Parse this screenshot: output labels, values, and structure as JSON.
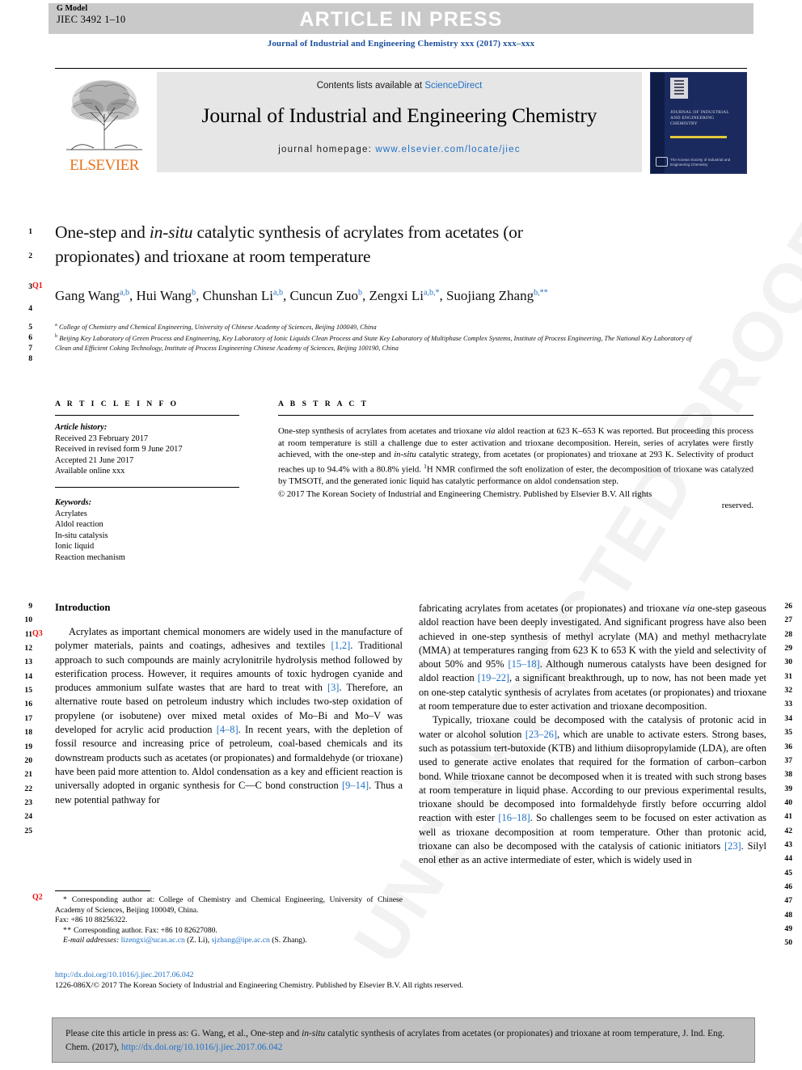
{
  "header": {
    "g_model_label": "G Model",
    "manuscript_id": "JIEC 3492 1–10",
    "article_in_press": "ARTICLE IN PRESS",
    "journal_ref": "Journal of Industrial and Engineering Chemistry xxx (2017) xxx–xxx"
  },
  "masthead": {
    "contents_prefix": "Contents lists available at ",
    "sciencedirect": "ScienceDirect",
    "journal_title": "Journal of Industrial and Engineering Chemistry",
    "homepage_prefix": "journal homepage: ",
    "homepage_url": "www.elsevier.com/locate/jiec",
    "publisher_wordmark": "ELSEVIER",
    "cover_title": "Journal of Industrial and Engineering Chemistry",
    "cover_footer": "The Korean Society of Industrial and Engineering Chemistry"
  },
  "article": {
    "title_line1_a": "One-step and ",
    "title_line1_em": "in-situ",
    "title_line1_b": " catalytic synthesis of acrylates from acetates",
    "title_line2": "(or propionates) and trioxane at room temperature",
    "authors": [
      {
        "name": "Gang Wang",
        "sup": "a,b",
        "sep": ", "
      },
      {
        "name": "Hui Wang",
        "sup": "b",
        "sep": ", "
      },
      {
        "name": "Chunshan Li",
        "sup": "a,b",
        "sep": ", "
      },
      {
        "name": "Cuncun Zuo",
        "sup": "b",
        "sep": ", "
      },
      {
        "name": "Zengxi Li",
        "sup": "a,b,*",
        "sep": ","
      },
      {
        "name": "Suojiang Zhang",
        "sup": "b,**",
        "sep": ""
      }
    ],
    "affiliations": [
      {
        "marker": "a",
        "text": "College of Chemistry and Chemical Engineering, University of Chinese Academy of Sciences, Beijing 100049, China"
      },
      {
        "marker": "b",
        "text": "Beijing Key Laboratory of Green Process and Engineering, Key Laboratory of Ionic Liquids Clean Process and State Key Laboratory of Multiphase Complex Systems, Institute of Process Engineering, The National Key Laboratory of Clean and Efficient Coking Technology, Institute of Process Engineering Chinese Academy of Sciences, Beijing 100190, China"
      }
    ]
  },
  "article_info": {
    "heading": "A R T I C L E  I N F O",
    "history_label": "Article history:",
    "history": [
      "Received 23 February 2017",
      "Received in revised form 9 June 2017",
      "Accepted 21 June 2017",
      "Available online xxx"
    ],
    "keywords_label": "Keywords:",
    "keywords": [
      "Acrylates",
      "Aldol reaction",
      "In-situ catalysis",
      "Ionic liquid",
      "Reaction mechanism"
    ]
  },
  "abstract": {
    "heading": "A B S T R A C T",
    "part1": "One-step synthesis of acrylates from acetates and trioxane ",
    "via1": "via",
    "part2": " aldol reaction at 623 K–653 K was reported. But proceeding this process at room temperature is still a challenge due to ester activation and trioxane decomposition. Herein, series of acrylates were firstly achieved, with the one-step and ",
    "insitu": "in-situ",
    "part3": " catalytic strategy, from acetates (or propionates) and trioxane at 293 K. Selectivity of product reaches up to 94.4% with a 80.8% yield. ",
    "nmr_sup": "1",
    "part4": "H NMR confirmed the soft enolization of ester, the decomposition of trioxane was catalyzed by TMSOTf, and the generated ionic liquid has catalytic performance on aldol condensation step.",
    "copyright": "© 2017 The Korean Society of Industrial and Engineering Chemistry. Published by Elsevier B.V. All rights",
    "copyright_last": "reserved."
  },
  "body": {
    "section_heading": "Introduction",
    "left_paragraphs": [
      {
        "segments": [
          {
            "t": "Acrylates as important chemical monomers are widely used in the manufacture of polymer materials, paints and coatings, adhesives and textiles "
          },
          {
            "t": "[1,2]",
            "k": "ref"
          },
          {
            "t": ". Traditional approach to such compounds are mainly acrylonitrile hydrolysis method followed by esterification process. However, it requires amounts of toxic hydrogen cyanide and produces ammonium sulfate wastes that are hard to treat with "
          },
          {
            "t": "[3]",
            "k": "ref"
          },
          {
            "t": ". Therefore, an alternative route based on petroleum industry which includes two-step oxidation of propylene (or isobutene) over mixed metal oxides of Mo–Bi and Mo–V was developed for acrylic acid production "
          },
          {
            "t": "[4–8]",
            "k": "ref"
          },
          {
            "t": ". In recent years, with the depletion of fossil resource and increasing price of petroleum, coal-based chemicals and its downstream products such as acetates (or propionates) and formaldehyde (or trioxane) have been paid more attention to. Aldol condensation as a key and efficient reaction is universally adopted in organic synthesis for C—C bond construction "
          },
          {
            "t": "[9–14]",
            "k": "ref"
          },
          {
            "t": ". Thus a new potential pathway for"
          }
        ]
      }
    ],
    "right_paragraphs": [
      {
        "indent": false,
        "segments": [
          {
            "t": "fabricating acrylates from acetates (or propionates) and trioxane "
          },
          {
            "t": "via",
            "k": "em"
          },
          {
            "t": " one-step gaseous aldol reaction have been deeply investigated. And significant progress have also been achieved in one-step synthesis of methyl acrylate (MA) and methyl methacrylate (MMA) at temperatures ranging from 623 K to 653 K with the yield and selectivity of about 50% and 95% "
          },
          {
            "t": "[15–18]",
            "k": "ref"
          },
          {
            "t": ". Although numerous catalysts have been designed for aldol reaction "
          },
          {
            "t": "[19–22]",
            "k": "ref"
          },
          {
            "t": ", a significant breakthrough, up to now, has not been made yet on one-step catalytic synthesis of acrylates from acetates (or propionates) and trioxane at room temperature due to ester activation and trioxane decomposition."
          }
        ]
      },
      {
        "indent": true,
        "segments": [
          {
            "t": "Typically, trioxane could be decomposed with the catalysis of protonic acid in water or alcohol solution "
          },
          {
            "t": "[23–26]",
            "k": "ref"
          },
          {
            "t": ", which are unable to activate esters. Strong bases, such as potassium tert-butoxide (KTB) and lithium diisopropylamide (LDA), are often used to generate active enolates that required for the formation of carbon–carbon bond. While trioxane cannot be decomposed when it is treated with such strong bases at room temperature in liquid phase. According to our previous experimental results, trioxane should be decomposed into formaldehyde firstly before occurring aldol reaction with ester "
          },
          {
            "t": "[16–18]",
            "k": "ref"
          },
          {
            "t": ". So challenges seem to be focused on ester activation as well as trioxane decomposition at room temperature. Other than protonic acid, trioxane can also be decomposed with the catalysis of cationic initiators "
          },
          {
            "t": "[23]",
            "k": "ref"
          },
          {
            "t": ". Silyl enol ether as an active intermediate of ester, which is widely used in"
          }
        ]
      }
    ]
  },
  "footnotes": {
    "star1_marker": "*",
    "star1_text": "Corresponding author at: College of Chemistry and Chemical Engineering, University of Chinese Academy of Sciences, Beijing 100049, China.",
    "fax1": "Fax: +86 10 88256322.",
    "star2_marker": "**",
    "star2_text": "Corresponding author. Fax: +86 10 82627080.",
    "email_label": "E-mail addresses:",
    "email1": "lizengxi@ucas.ac.cn",
    "email1_who": "(Z. Li),",
    "email2": "sjzhang@ipe.ac.cn",
    "email2_who": "(S. Zhang)."
  },
  "doi_block": {
    "doi_url": "http://dx.doi.org/10.1016/j.jiec.2017.06.042",
    "issn_copyright": "1226-086X/© 2017 The Korean Society of Industrial and Engineering Chemistry. Published by Elsevier B.V. All rights reserved."
  },
  "cite_footer": {
    "prefix": "Please cite this article in press as: G. Wang, et al., One-step and ",
    "em": "in-situ",
    "middle": " catalytic synthesis of acrylates from acetates (or propionates) and trioxane at room temperature, J. Ind. Eng. Chem. (2017), ",
    "doi": "http://dx.doi.org/10.1016/j.jiec.2017.06.042"
  },
  "line_numbers": {
    "title_block": [
      "1",
      "2",
      "3",
      "4",
      "5",
      "6",
      "7",
      "8"
    ],
    "left_column": [
      "9",
      "10",
      "11",
      "12",
      "13",
      "14",
      "15",
      "16",
      "17",
      "18",
      "19",
      "20",
      "21",
      "22",
      "23",
      "24",
      "25"
    ],
    "right_column": [
      "26",
      "27",
      "28",
      "29",
      "30",
      "31",
      "32",
      "33",
      "34",
      "35",
      "36",
      "37",
      "38",
      "39",
      "40",
      "41",
      "42",
      "43",
      "44",
      "45",
      "46",
      "47",
      "48",
      "49",
      "50"
    ]
  },
  "query_markers": [
    {
      "label": "Q1"
    },
    {
      "label": "Q3"
    },
    {
      "label": "Q2"
    }
  ],
  "watermark": {
    "text": "UNCORRECTED PROOF"
  },
  "colors": {
    "link_blue": "#1f6fc4",
    "header_blue": "#1a4f9c",
    "query_red": "#ee1111",
    "elsevier_orange": "#e8721c",
    "banner_gray": "#c9c9c9",
    "cover_navy": "#1b2a5e"
  }
}
